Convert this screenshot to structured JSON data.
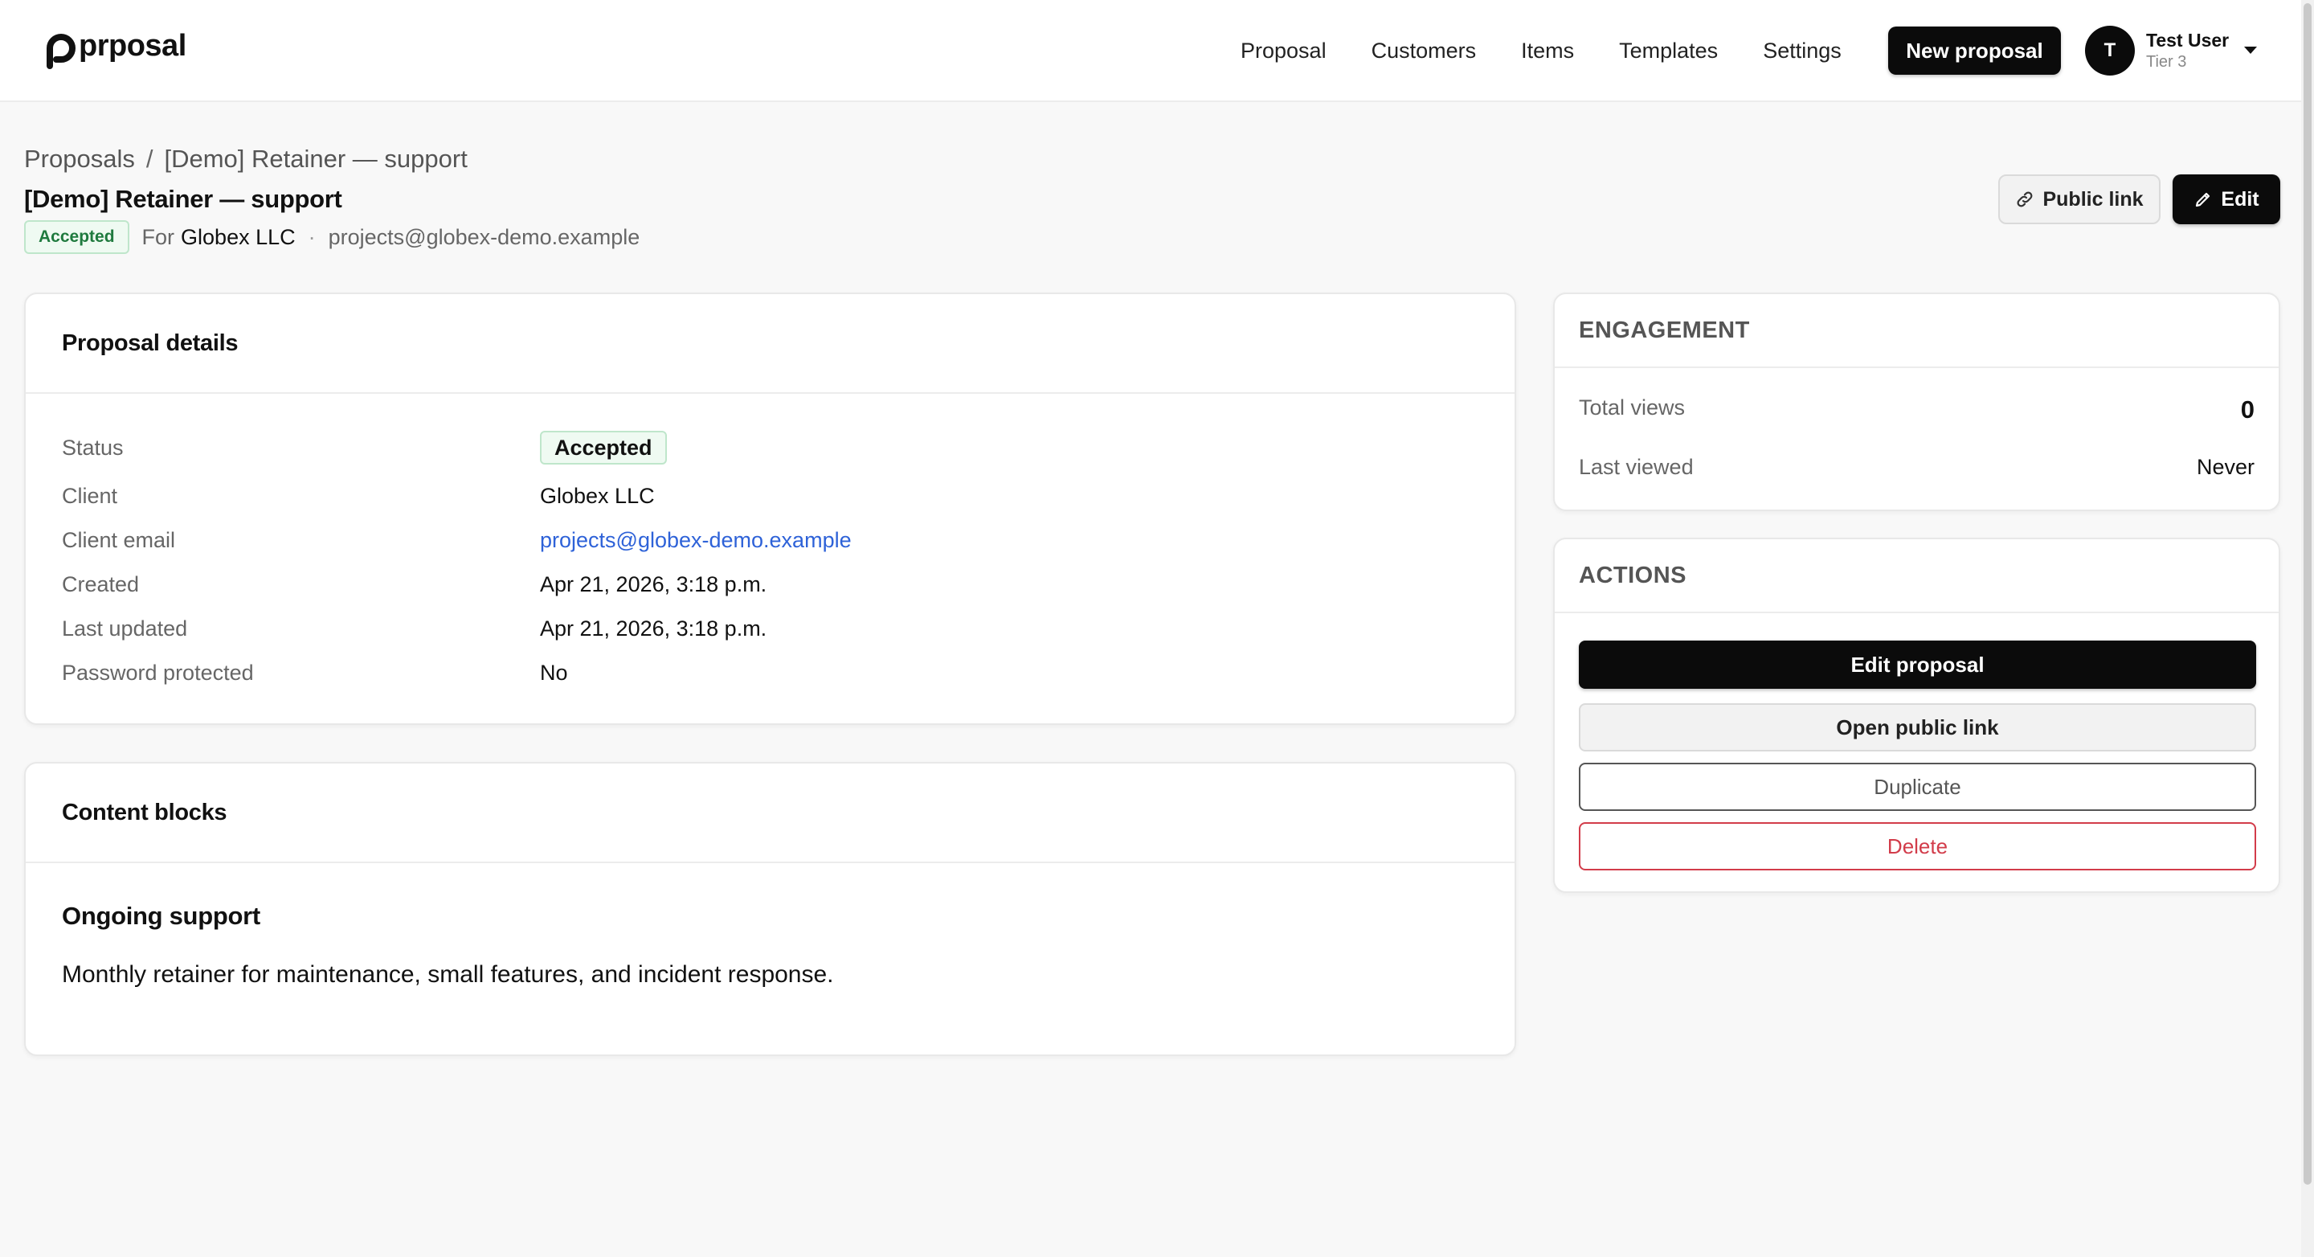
{
  "brand": {
    "name": "prposal"
  },
  "nav": {
    "links": [
      "Proposal",
      "Customers",
      "Items",
      "Templates",
      "Settings"
    ],
    "new_button": "New proposal"
  },
  "user": {
    "initial": "T",
    "name": "Test User",
    "tier": "Tier 3"
  },
  "page": {
    "breadcrumb": {
      "root": "Proposals",
      "separator": "/",
      "current": "[Demo] Retainer — support"
    },
    "title": "[Demo] Retainer — support",
    "status": "Accepted",
    "for_label": "For",
    "client": "Globex LLC",
    "dot": "·",
    "email": "projects@globex-demo.example",
    "public_link_button": "Public link",
    "edit_button": "Edit"
  },
  "details": {
    "title": "Proposal details",
    "rows": [
      {
        "label": "Status",
        "value": "Accepted"
      },
      {
        "label": "Client",
        "value": "Globex LLC"
      },
      {
        "label": "Client email",
        "value": "projects@globex-demo.example"
      },
      {
        "label": "Created",
        "value": "Apr 21, 2026, 3:18 p.m."
      },
      {
        "label": "Last updated",
        "value": "Apr 21, 2026, 3:18 p.m."
      },
      {
        "label": "Password protected",
        "value": "No"
      }
    ]
  },
  "content": {
    "title": "Content blocks",
    "block_title": "Ongoing support",
    "block_text": "Monthly retainer for maintenance, small features, and incident response."
  },
  "engagement": {
    "title": "ENGAGEMENT",
    "total_views_label": "Total views",
    "total_views": "0",
    "last_viewed_label": "Last viewed",
    "last_viewed": "Never"
  },
  "actions": {
    "title": "ACTIONS",
    "edit": "Edit proposal",
    "open_public": "Open public link",
    "duplicate": "Duplicate",
    "delete": "Delete"
  },
  "colors": {
    "primary": "#0b0b0b",
    "accent_link": "#2e62d8",
    "success": "#1f7a3e",
    "danger": "#d23c4a"
  }
}
